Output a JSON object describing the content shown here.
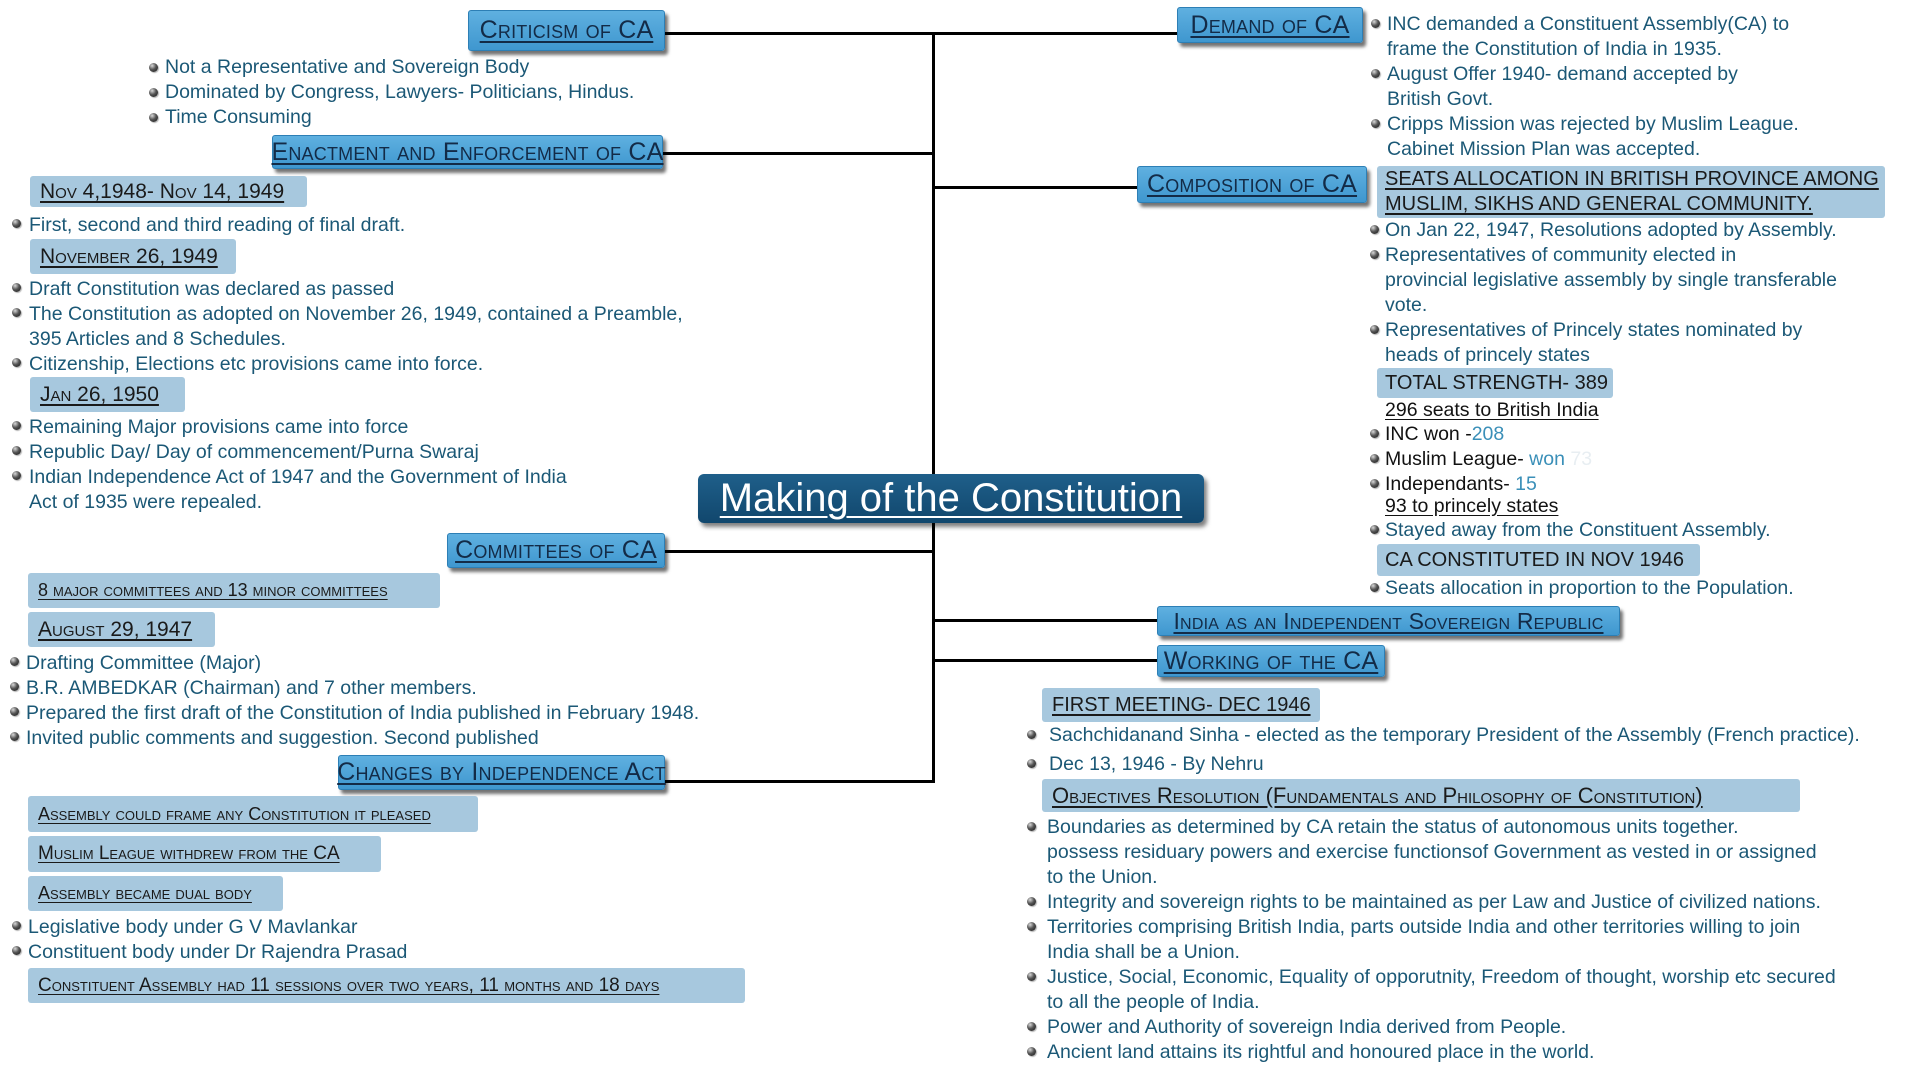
{
  "title": "Making of the Constitution",
  "criticism": {
    "header": "Criticism of CA",
    "bullets": [
      "Not a Representative and Sovereign Body",
      "Dominated by Congress, Lawyers- Politicians, Hindus.",
      "Time Consuming"
    ]
  },
  "enactment": {
    "header": "Enactment and Enforcement of CA",
    "date1": "Nov 4,1948- Nov 14, 1949",
    "date1_bullets": [
      "First, second and third reading of final draft."
    ],
    "date2": "November 26, 1949",
    "date2_bullets": [
      "Draft Constitution was declared as passed",
      "The Constitution as adopted on November 26, 1949, contained a Preamble,",
      "395 Articles and 8 Schedules.",
      "Citizenship, Elections etc provisions came into force."
    ],
    "date3": "Jan 26, 1950",
    "date3_bullets": [
      "Remaining Major provisions came into force",
      "Republic Day/ Day of commencement/Purna Swaraj",
      "Indian Independence Act of 1947 and the Government of India",
      "Act of 1935 were repealed."
    ]
  },
  "committees": {
    "header": "Committees of CA",
    "box1": "8 major committees and 13 minor committees",
    "box2": "August 29, 1947",
    "bullets": [
      "Drafting Committee (Major)",
      "B.R. AMBEDKAR (Chairman) and 7 other members.",
      "Prepared the first draft of the Constitution of India published in February 1948.",
      "Invited public comments and suggestion. Second published"
    ]
  },
  "changes": {
    "header": "Changes by Independence Act",
    "box1": "Assembly could frame any Constitution it pleased",
    "box2": "Muslim League withdrew from the CA",
    "box3": "Assembly became dual body",
    "bullets": [
      "Legislative body under G V Mavlankar",
      "Constituent body under Dr Rajendra Prasad"
    ],
    "box4": "Constituent Assembly had 11 sessions over two years, 11 months and 18 days"
  },
  "demand": {
    "header": "Demand of CA",
    "bullets": [
      "INC demanded a Constituent Assembly(CA) to",
      "frame the Constitution of India in 1935.",
      "August Offer 1940- demand accepted by",
      "British Govt.",
      "Cripps Mission was rejected by Muslim League.",
      "Cabinet Mission Plan was accepted."
    ]
  },
  "composition": {
    "header": "Composition of CA",
    "seats_box_line1": "SEATS ALLOCATION IN BRITISH PROVINCE AMONG",
    "seats_box_line2": "MUSLIM, SIKHS AND GENERAL COMMUNITY.",
    "bullets": [
      "On Jan 22, 1947, Resolutions adopted by Assembly.",
      "Representatives of community elected in",
      "provincial legislative assembly by single transferable",
      "vote.",
      "Representatives of Princely states nominated by",
      "heads of princely states"
    ],
    "total_strength": "TOTAL STRENGTH- 389",
    "british_india": "296 seats to British India",
    "inc_label": "INC won -",
    "inc_value": "208",
    "ml_label": "Muslim League-",
    "ml_won": " won ",
    "ml_value": "73",
    "ind_label": "Independants-",
    "ind_value": " 15",
    "princely": "93 to princely states",
    "stayed_away": "Stayed away from the Constituent Assembly.",
    "constituted": "CA CONSTITUTED IN NOV 1946",
    "seats_allocation": "Seats allocation in proportion to the Population."
  },
  "india_republic": {
    "header": "India as an Independent Sovereign Republic"
  },
  "working": {
    "header": "Working of the CA",
    "first_meeting": "FIRST MEETING- DEC 1946",
    "bullets": [
      "Sachchidanand Sinha - elected as the temporary President of the Assembly (French practice).",
      "Dec 13, 1946 - By Nehru"
    ],
    "objectives": "Objectives Resolution (Fundamentals and Philosophy of Constitution)",
    "objective_bullets": [
      "Boundaries as determined by CA retain the status of autonomous units together.",
      "possess residuary powers and exercise functionsof Government as vested in or assigned",
      "to the Union.",
      "Integrity and sovereign rights to be maintained as per Law and Justice of civilized nations.",
      "Territories comprising British India, parts outside India and other territories willing to join",
      "India shall be a Union.",
      "Justice, Social, Economic, Equality of opporutnity, Freedom of thought, worship etc secured",
      "to all the people of India.",
      "Power and Authority of sovereign India derived from People.",
      "Ancient land attains its rightful and honoured place in the world."
    ]
  }
}
